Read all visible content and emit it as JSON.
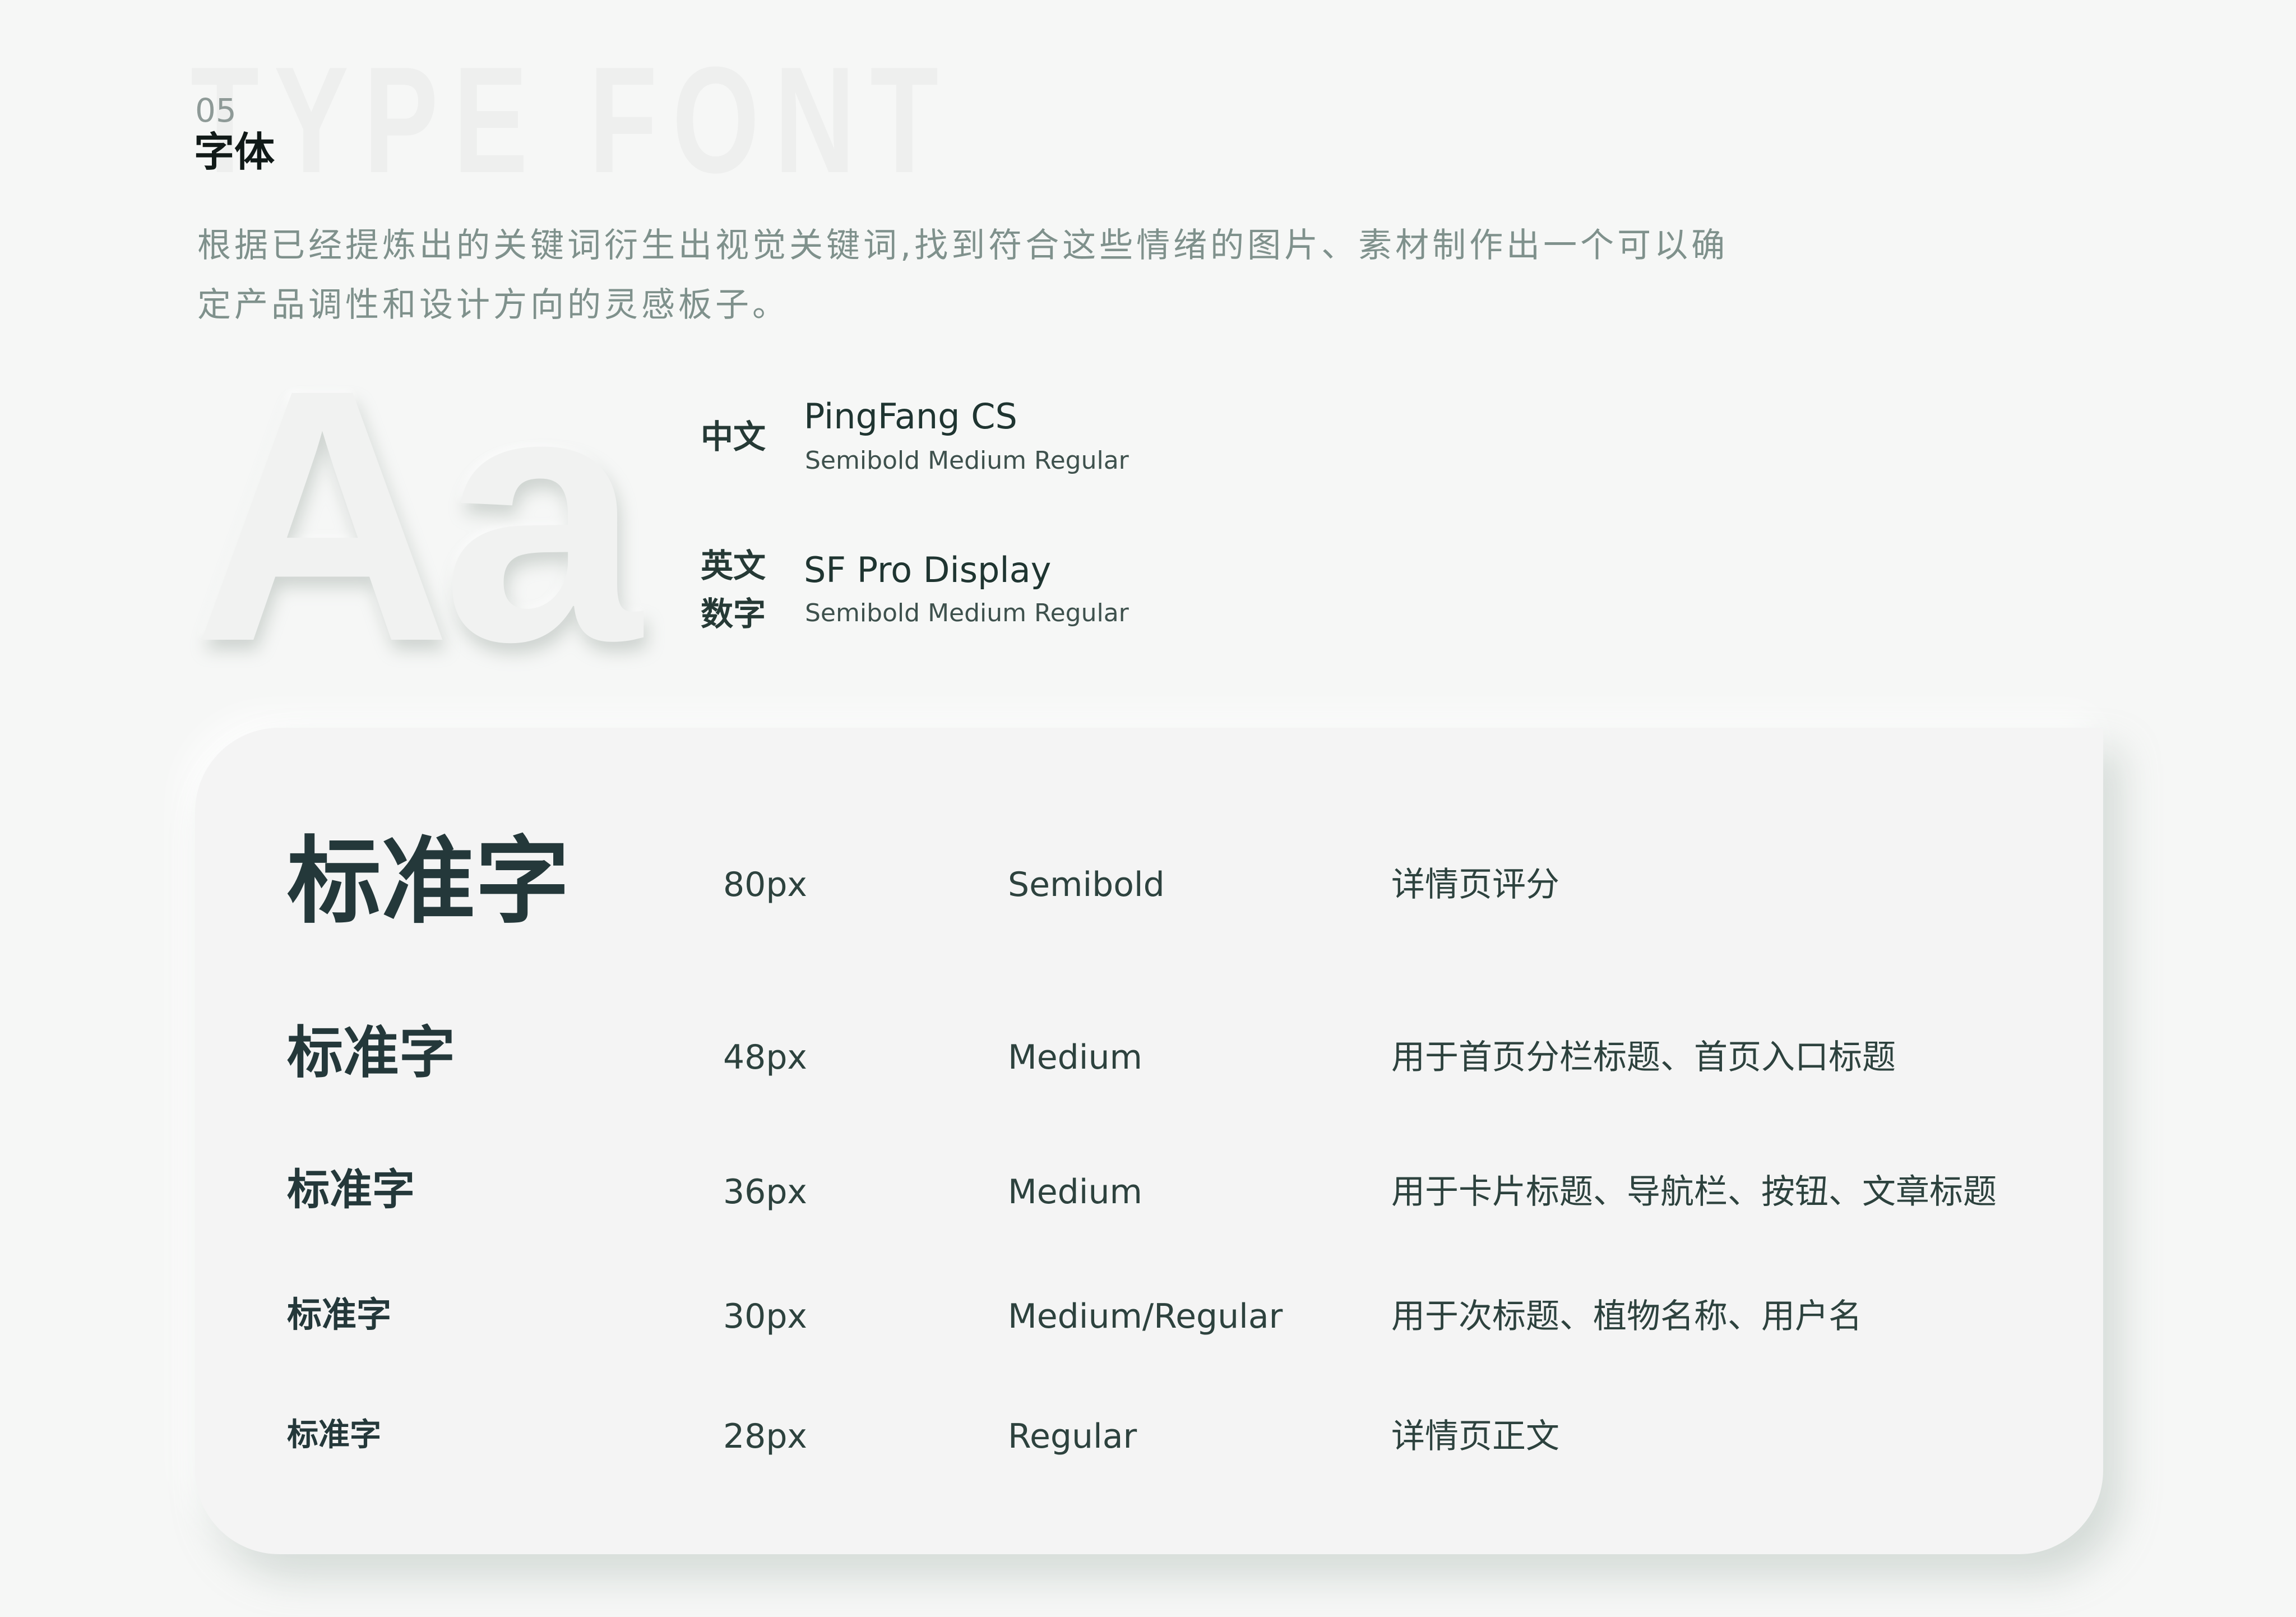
{
  "header": {
    "watermark": "TYPE FONT",
    "number": "05",
    "title": "字体",
    "intro": "根据已经提炼出的关键词衍生出视觉关键词,找到符合这些情绪的图片、素材制作出一个可以确定产品调性和设计方向的灵感板子。"
  },
  "glyph": "Aa",
  "fonts": [
    {
      "label": "中文",
      "name": "PingFang CS",
      "weights": "Semibold Medium Regular"
    },
    {
      "label": "英文\n数字",
      "name": "SF Pro Display",
      "weights": "Semibold Medium Regular"
    }
  ],
  "type_scale": [
    {
      "sample": "标准字",
      "size": "80px",
      "weight": "Semibold",
      "usage": "详情页评分"
    },
    {
      "sample": "标准字",
      "size": "48px",
      "weight": "Medium",
      "usage": "用于首页分栏标题、首页入口标题"
    },
    {
      "sample": "标准字",
      "size": "36px",
      "weight": "Medium",
      "usage": "用于卡片标题、导航栏、按钮、文章标题"
    },
    {
      "sample": "标准字",
      "size": "30px",
      "weight": "Medium/Regular",
      "usage": "用于次标题、植物名称、用户名"
    },
    {
      "sample": "标准字",
      "size": "28px",
      "weight": "Regular",
      "usage": "详情页正文"
    }
  ],
  "colors": {
    "background": "#f6f7f6",
    "card": "#f4f4f4",
    "text_dark": "#24383a",
    "text_muted": "#7f918c"
  }
}
